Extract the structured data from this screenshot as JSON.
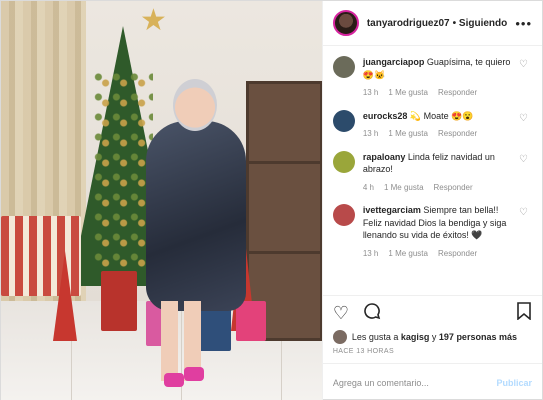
{
  "header": {
    "username": "tanyarodriguez07",
    "separator_follow": "• Siguiendo",
    "more_icon": "more-icon"
  },
  "comments": [
    {
      "username": "juangarciapop",
      "text": "Guapísima, te quiero 😍🐱",
      "time": "13 h",
      "likes": "1 Me gusta",
      "reply": "Responder",
      "avatar_color": "#6b6b5a"
    },
    {
      "username": "eurocks28",
      "text": "💫 Moate 😍😮",
      "time": "13 h",
      "likes": "1 Me gusta",
      "reply": "Responder",
      "avatar_color": "#2c4b6b"
    },
    {
      "username": "rapaloany",
      "text": "Linda feliz navidad un abrazo!",
      "time": "4 h",
      "likes": "1 Me gusta",
      "reply": "Responder",
      "avatar_color": "#9aa63a"
    },
    {
      "username": "ivettegarciam",
      "text": "Siempre tan bella!! Feliz navidad Dios la bendiga y siga llenando su vida de éxitos! 🖤",
      "time": "13 h",
      "likes": "1 Me gusta",
      "reply": "Responder",
      "avatar_color": "#b84a4a"
    }
  ],
  "actions": {
    "like_icon": "heart-icon",
    "comment_icon": "comment-icon",
    "save_icon": "bookmark-icon"
  },
  "likes": {
    "prefix": "Les gusta a",
    "user": "kagisg",
    "middle": "y",
    "count": "197 personas más"
  },
  "timestamp": "HACE 13 HORAS",
  "add_comment": {
    "placeholder": "Agrega un comentario...",
    "publish_label": "Publicar"
  },
  "colors": {
    "accent_disabled": "#b3dbff",
    "muted_text": "#8e8e8e",
    "border": "#efefef"
  }
}
